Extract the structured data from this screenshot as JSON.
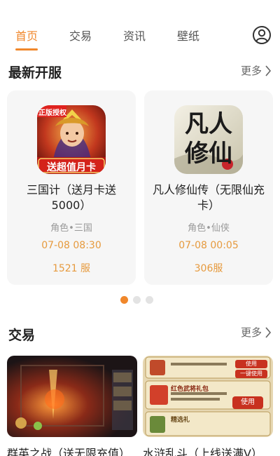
{
  "nav": {
    "tabs": [
      {
        "label": "首页",
        "active": true
      },
      {
        "label": "交易",
        "active": false
      },
      {
        "label": "资讯",
        "active": false
      },
      {
        "label": "壁纸",
        "active": false
      }
    ],
    "accent_color": "#f0872b",
    "profile_icon": "user-circle-icon"
  },
  "new_servers": {
    "title": "最新开服",
    "more_label": "更多",
    "cards": [
      {
        "name": "三国计（送月卡送5000）",
        "icon_banner": "送超值月卡",
        "icon_badge": "正版授权",
        "tag": "角色•三国",
        "time": "07-08 08:30",
        "server": "1521 服"
      },
      {
        "name": "凡人修仙传（无限仙充卡）",
        "icon_calligraphy": "凡人修仙",
        "tag": "角色•仙侠",
        "time": "07-08 00:05",
        "server": "306服"
      }
    ],
    "pager": {
      "count": 3,
      "active_index": 0
    }
  },
  "trade": {
    "title": "交易",
    "more_label": "更多",
    "items": [
      {
        "name": "群英之战（送无限充值）"
      },
      {
        "name": "水浒乱斗（上线送满V）",
        "thumb_buttons": [
          "使用",
          "一键使用",
          "使用"
        ],
        "thumb_text": [
          "红色武将礼包",
          "精选礼"
        ]
      }
    ]
  }
}
